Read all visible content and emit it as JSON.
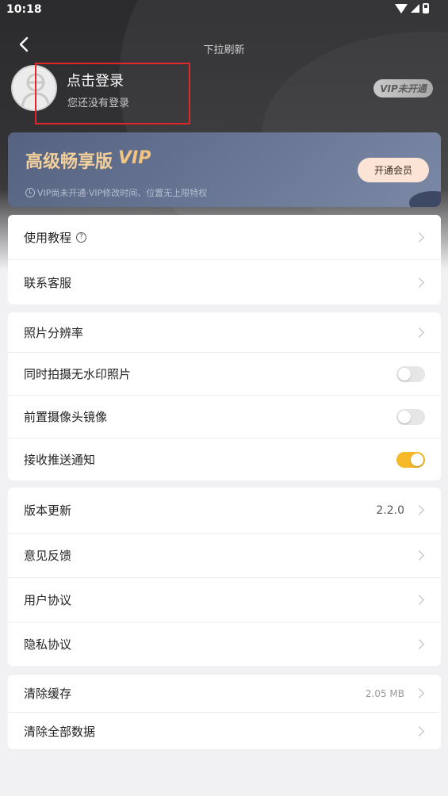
{
  "status_bar": {
    "time": "10:18"
  },
  "header": {
    "refresh_hint": "下拉刷新",
    "login_title": "点击登录",
    "login_subtitle": "您还没有登录",
    "vip_badge": "VIP未开通"
  },
  "vip_card": {
    "title": "高级畅享版",
    "logo": "VIP",
    "description": "VIP尚未开通·VIP修改时间、位置无上限特权",
    "button_label": "开通会员"
  },
  "section1": {
    "items": [
      {
        "label": "使用教程",
        "has_help_icon": true
      },
      {
        "label": "联系客服"
      }
    ]
  },
  "section2": {
    "items": [
      {
        "label": "照片分辨率"
      },
      {
        "label": "同时拍摄无水印照片",
        "toggle": false
      },
      {
        "label": "前置摄像头镜像",
        "toggle": false
      },
      {
        "label": "接收推送通知",
        "toggle": true
      }
    ]
  },
  "section3": {
    "items": [
      {
        "label": "版本更新",
        "value": "2.2.0"
      },
      {
        "label": "意见反馈"
      },
      {
        "label": "用户协议"
      },
      {
        "label": "隐私协议"
      }
    ]
  },
  "section4": {
    "items": [
      {
        "label": "清除缓存",
        "value": "2.05 MB"
      },
      {
        "label": "清除全部数据"
      }
    ]
  },
  "colors": {
    "accent_toggle": "#f5b92a",
    "vip_gold": "#f2c47f",
    "highlight_box": "#e2262b"
  }
}
